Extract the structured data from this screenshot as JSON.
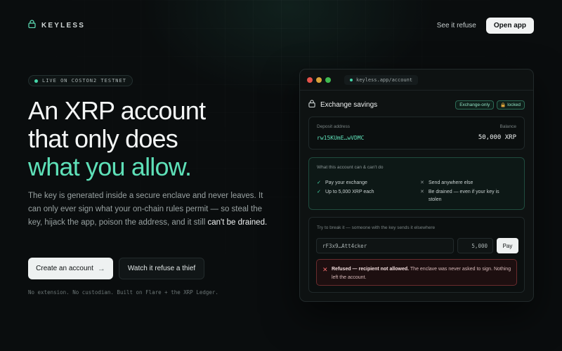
{
  "header": {
    "brand": "KEYLESS",
    "nav_link": "See it refuse",
    "cta": "Open app"
  },
  "hero": {
    "status_pill": "LIVE ON COSTON2 TESTNET",
    "headline_line1": "An XRP account",
    "headline_line2": "that only does",
    "headline_accent": "what you allow.",
    "description": "The key is generated inside a secure enclave and never leaves. It can only ever sign what your on-chain rules permit — so steal the key, hijack the app, poison the address, and it still ",
    "description_strong": "can't be drained.",
    "primary_button": "Create an account",
    "primary_arrow": "→",
    "secondary_button": "Watch it refuse a thief",
    "footnote": "No extension. No custodian. Built on Flare + the XRP Ledger."
  },
  "app": {
    "url": "keyless.app/account",
    "account_name": "Exchange savings",
    "badge_mode": "Exchange-only",
    "badge_locked": "locked",
    "deposit_label": "Deposit address",
    "deposit_value": "rw15KUmE…wVDMC",
    "balance_label": "Balance",
    "balance_value": "50,000 XRP",
    "rules_title": "What this account can & can't do",
    "can": [
      "Pay your exchange",
      "Up to 5,000 XRP each"
    ],
    "cannot": [
      "Send anywhere else",
      "Be drained — even if your key is stolen"
    ],
    "test_title": "Try to break it — someone with the key sends it elsewhere",
    "test_address": "rF3x9…Att4cker",
    "test_amount": "5,000",
    "pay_button": "Pay",
    "alert_strong": "Refused — recipient not allowed.",
    "alert_rest": " The enclave was never asked to sign. Nothing left the account."
  },
  "colors": {
    "background": "#0a0d0e",
    "accent": "#5ee0b8",
    "danger": "#f06b6b",
    "window_red": "#e5534b",
    "window_yellow": "#d9a23a",
    "window_green": "#3fb950"
  },
  "icons": {
    "brand": "lock-icon",
    "check": "check-icon",
    "cross": "x-icon"
  }
}
